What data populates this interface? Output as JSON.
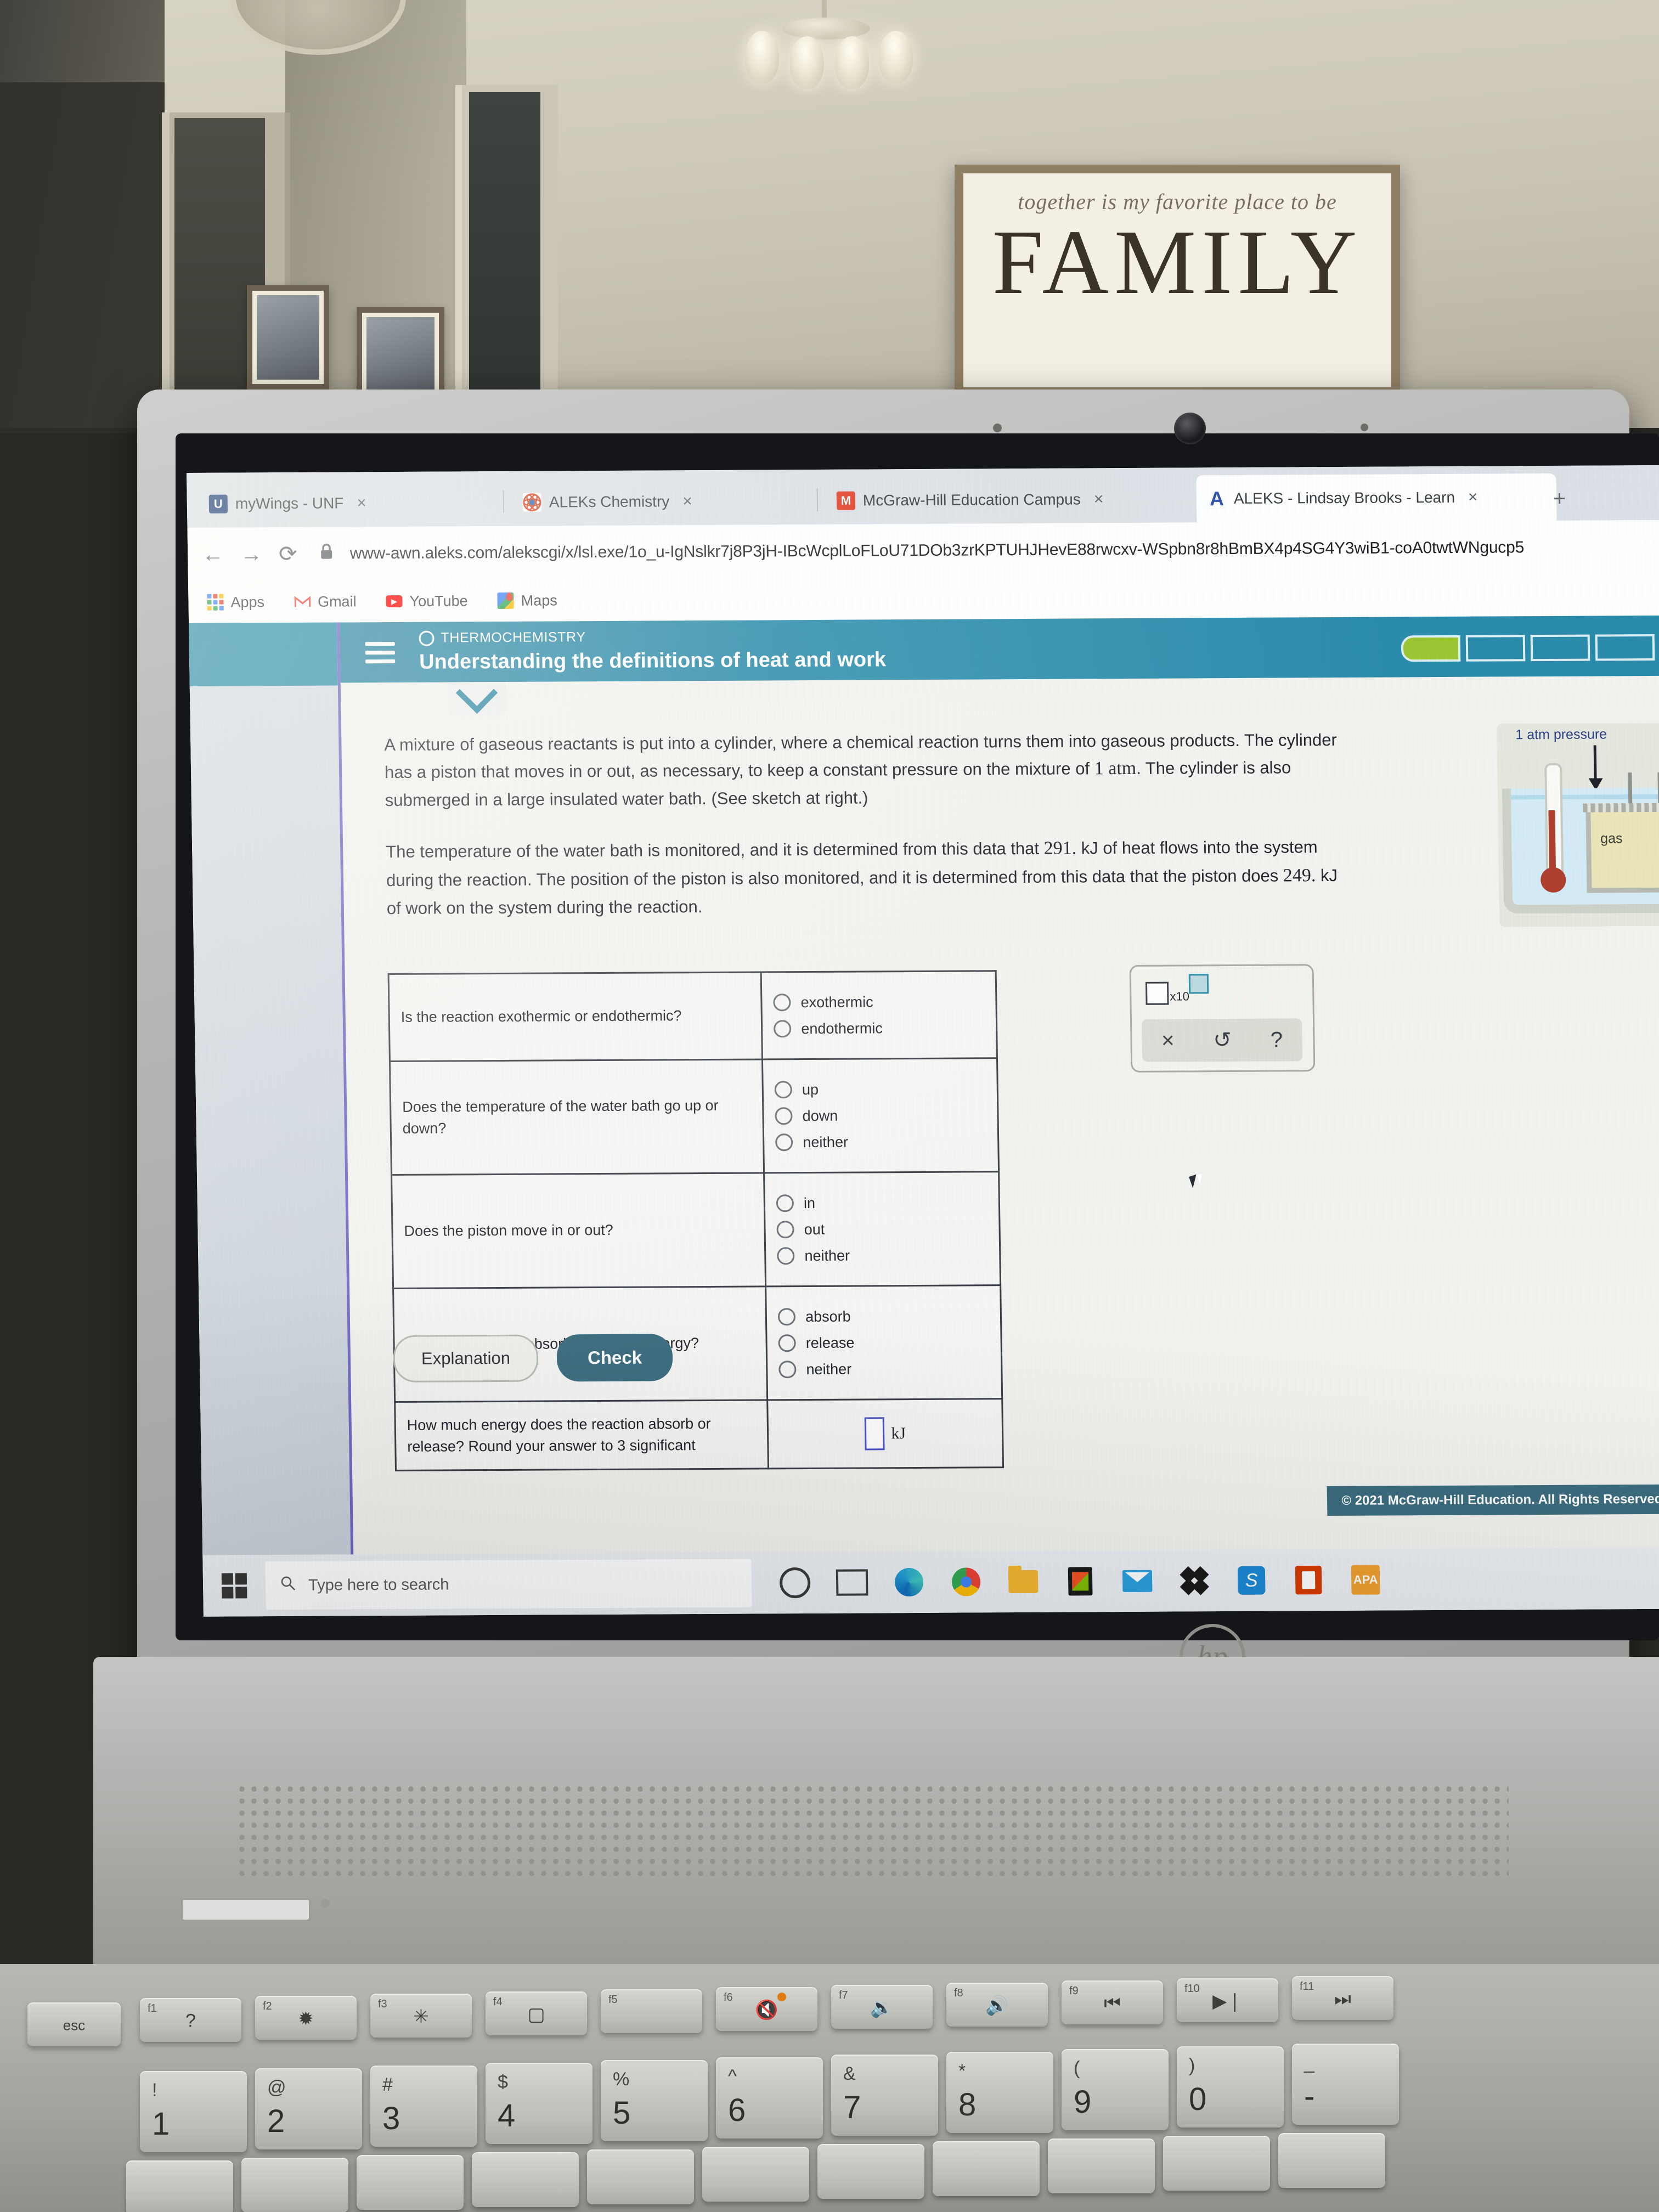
{
  "room": {
    "family_sign_script": "together is my favorite place to be",
    "family_sign_word": "FAMILY"
  },
  "browser": {
    "tabs": [
      {
        "title": "myWings - UNF",
        "favicon": "unf-logo-icon",
        "active": false,
        "close_label": "×"
      },
      {
        "title": "ALEKs Chemistry",
        "favicon": "aleks-chemistry-icon",
        "active": false,
        "close_label": "×"
      },
      {
        "title": "McGraw-Hill Education Campus",
        "favicon": "mcgraw-hill-icon",
        "active": false,
        "close_label": "×"
      },
      {
        "title": "ALEKS - Lindsay Brooks - Learn",
        "favicon": "aleks-a-icon",
        "active": true,
        "close_label": "×"
      }
    ],
    "new_tab_label": "+",
    "nav": {
      "back": "←",
      "forward": "→",
      "reload": "⟳",
      "lock": "🔒"
    },
    "url": "www-awn.aleks.com/alekscgi/x/lsl.exe/1o_u-IgNslkr7j8P3jH-IBcWcplLoFLoU71DOb3zrKPTUHJHevE88rwcxv-WSpbn8r8hBmBX4p4SG4Y3wiB1-coA0twtWNgucp5",
    "bookmarks": [
      {
        "label": "Apps",
        "icon": "apps-grid-icon"
      },
      {
        "label": "Gmail",
        "icon": "gmail-icon"
      },
      {
        "label": "YouTube",
        "icon": "youtube-icon"
      },
      {
        "label": "Maps",
        "icon": "google-maps-icon"
      }
    ]
  },
  "aleks": {
    "header": {
      "topic": "THERMOCHEMISTRY",
      "title": "Understanding the definitions of heat and work",
      "progress_segments": 4,
      "progress_filled": 1,
      "accent_color": "#2d8fae",
      "progress_fill_color": "#9ec734"
    },
    "problem": {
      "paragraph1_a": "A mixture of gaseous reactants is put into a cylinder, where a chemical reaction turns them into gaseous products. The cylinder has a piston that moves in or out, as necessary, to keep a constant pressure on the mixture of ",
      "paragraph1_pressure": "1 atm",
      "paragraph1_b": ". The cylinder is also submerged in a large insulated water bath. (See sketch at right.)",
      "paragraph2_a": "The temperature of the water bath is monitored, and it is determined from this data that ",
      "paragraph2_heat": "291.",
      "paragraph2_b": " kJ of heat flows into the system during the reaction. The position of the piston is also monitored, and it is determined from this data that the piston does ",
      "paragraph2_work": "249.",
      "paragraph2_c": " kJ of work on the system during the reaction."
    },
    "sketch": {
      "pressure_label": "1 atm pressure",
      "gas_label": "gas"
    },
    "table": {
      "rows": [
        {
          "question": "Is the reaction exothermic or endothermic?",
          "type": "radio",
          "options": [
            "exothermic",
            "endothermic"
          ],
          "selected": null
        },
        {
          "question": "Does the temperature of the water bath go up or down?",
          "type": "radio",
          "options": [
            "up",
            "down",
            "neither"
          ],
          "selected": null
        },
        {
          "question": "Does the piston move in or out?",
          "type": "radio",
          "options": [
            "in",
            "out",
            "neither"
          ],
          "selected": null
        },
        {
          "question": "Does the reaction absorb or release energy?",
          "type": "radio",
          "options": [
            "absorb",
            "release",
            "neither"
          ],
          "selected": null
        },
        {
          "question": "How much energy does the reaction absorb or release? Round your answer to 3 significant",
          "type": "input",
          "value": "",
          "unit": "kJ"
        }
      ]
    },
    "answer_toolbar": {
      "sci_notation_label": "x10",
      "clear_label": "×",
      "undo_label": "↺",
      "help_label": "?"
    },
    "buttons": {
      "explanation": "Explanation",
      "check": "Check"
    },
    "copyright": "© 2021 McGraw-Hill Education. All Rights Reserved."
  },
  "taskbar": {
    "start_label": "start-button",
    "search_placeholder": "Type here to search",
    "icons": [
      "cortana-icon",
      "task-view-icon",
      "edge-icon",
      "chrome-icon",
      "file-explorer-icon",
      "microsoft-store-icon",
      "mail-icon",
      "dropbox-icon",
      "skype-icon",
      "office-icon",
      "app-icon"
    ]
  },
  "laptop": {
    "brand": "hp"
  },
  "keyboard": {
    "esc": "esc",
    "fkeys": [
      {
        "fn": "f1",
        "glyph": "?"
      },
      {
        "fn": "f2",
        "glyph": "✹"
      },
      {
        "fn": "f3",
        "glyph": "✳"
      },
      {
        "fn": "f4",
        "glyph": "▢"
      },
      {
        "fn": "f5",
        "glyph": ""
      },
      {
        "fn": "f6",
        "glyph": "🔇"
      },
      {
        "fn": "f7",
        "glyph": "🔉"
      },
      {
        "fn": "f8",
        "glyph": "🔊"
      },
      {
        "fn": "f9",
        "glyph": "⏮"
      },
      {
        "fn": "f10",
        "glyph": "▶❘"
      },
      {
        "fn": "f11",
        "glyph": "⏭"
      }
    ],
    "numbers": [
      {
        "sym": "!",
        "num": "1"
      },
      {
        "sym": "@",
        "num": "2"
      },
      {
        "sym": "#",
        "num": "3"
      },
      {
        "sym": "$",
        "num": "4"
      },
      {
        "sym": "%",
        "num": "5"
      },
      {
        "sym": "^",
        "num": "6"
      },
      {
        "sym": "&",
        "num": "7"
      },
      {
        "sym": "*",
        "num": "8"
      },
      {
        "sym": "(",
        "num": "9"
      },
      {
        "sym": ")",
        "num": "0"
      },
      {
        "sym": "_",
        "num": "-"
      }
    ]
  }
}
